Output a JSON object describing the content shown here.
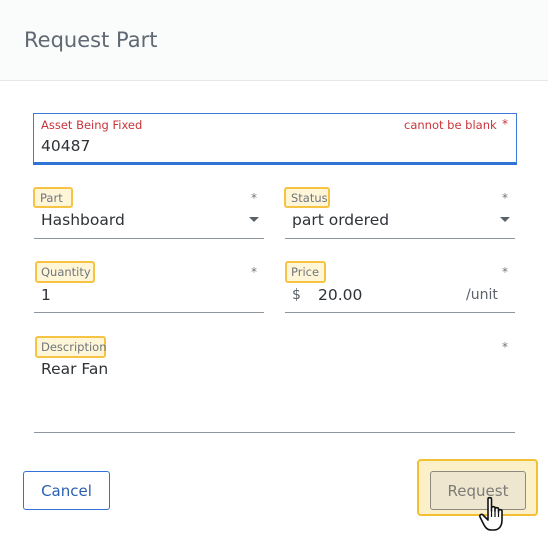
{
  "dialog": {
    "title": "Request Part"
  },
  "asset": {
    "label": "Asset Being Fixed",
    "error": "cannot be blank",
    "required_mark": "*",
    "value": "40487"
  },
  "part": {
    "label": "Part",
    "required_mark": "*",
    "value": "Hashboard"
  },
  "status": {
    "label": "Status",
    "required_mark": "*",
    "value": "part ordered"
  },
  "quantity": {
    "label": "Quantity",
    "required_mark": "*",
    "value": "1"
  },
  "price": {
    "label": "Price",
    "required_mark": "*",
    "currency": "$",
    "value": "20.00",
    "unit": "/unit"
  },
  "description": {
    "label": "Description",
    "required_mark": "*",
    "value": "Rear Fan"
  },
  "actions": {
    "cancel": "Cancel",
    "request": "Request"
  },
  "icons": {
    "dropdown": "chevron-down-icon",
    "cursor": "hand-pointer-icon"
  },
  "colors": {
    "error": "#c8343a",
    "accent": "#2f73d6",
    "highlight": "#f6c344"
  }
}
